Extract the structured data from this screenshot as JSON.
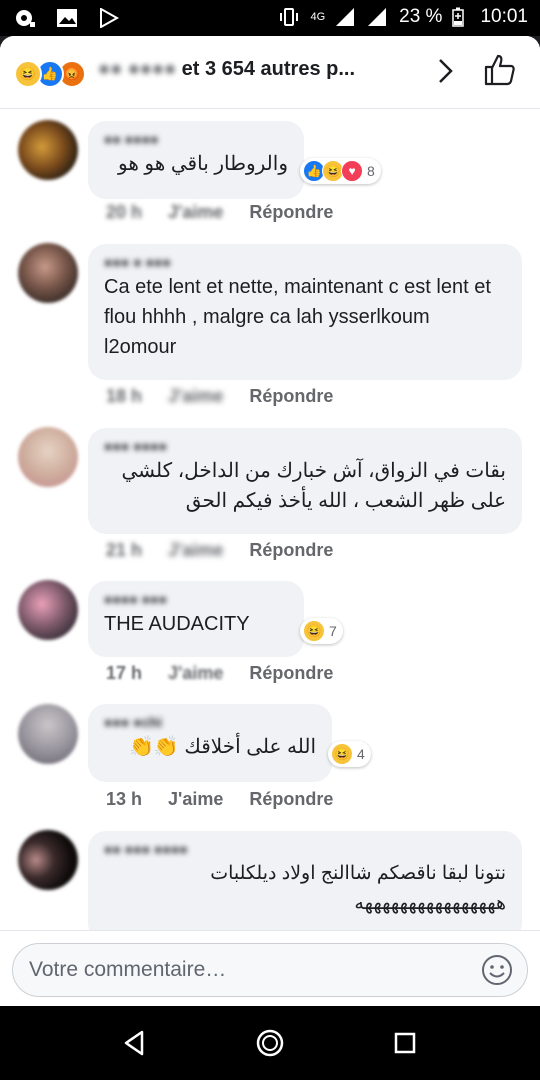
{
  "status_bar": {
    "network": "4G",
    "battery": "23 %",
    "time": "10:01"
  },
  "header": {
    "reactors_name": "●● ●●●●",
    "reactors_suffix": "et 3 654 autres p...",
    "reactions": [
      "haha-icon",
      "like-icon",
      "angry-icon"
    ]
  },
  "comments": [
    {
      "author": "●● ●●●●",
      "text": "والروطار باقي هو هو",
      "rtl": true,
      "time": "20 h",
      "like_label": "J'aime",
      "reply_label": "Répondre",
      "reaction_count": "8",
      "reactions": [
        "like-icon",
        "haha-icon",
        "love-icon"
      ]
    },
    {
      "author": "●●● ● ●●●",
      "text": "Ca ete lent et nette, maintenant c est lent et flou hhhh , malgre ca lah ysserlkoum l2omour",
      "rtl": false,
      "time": "18 h",
      "like_label": "J'aime",
      "reply_label": "Répondre"
    },
    {
      "author": "●●● ●●●●",
      "text": "بقات في الزواق، آش خبارك من الداخل، كلشي على ظهر الشعب ، الله يأخذ فيكم الحق",
      "rtl": true,
      "time": "21 h",
      "like_label": "J'aime",
      "reply_label": "Répondre"
    },
    {
      "author": "●●●● ●●●",
      "text": "THE AUDACITY",
      "rtl": false,
      "time": "17 h",
      "like_label": "J'aime",
      "reply_label": "Répondre",
      "reaction_count": "7",
      "reactions": [
        "haha-icon"
      ]
    },
    {
      "author": "●●● ●chi",
      "text": "الله على أخلاقك 👏👏",
      "rtl": true,
      "time": "13 h",
      "like_label": "J'aime",
      "reply_label": "Répondre",
      "reaction_count": "4",
      "reactions": [
        "haha-icon"
      ]
    },
    {
      "author": "●● ●●● ●●●●",
      "text": "نتونا لبقا ناقصكم شاالنج اولاد ديلكلبات ههههههههههههههههه",
      "rtl": true
    }
  ],
  "composer": {
    "placeholder": "Votre commentaire…"
  },
  "colors": {
    "like_blue": "#1877f2",
    "haha_yellow": "#f7c33b",
    "love_red": "#f33e58",
    "bubble_bg": "#f0f2f5"
  }
}
